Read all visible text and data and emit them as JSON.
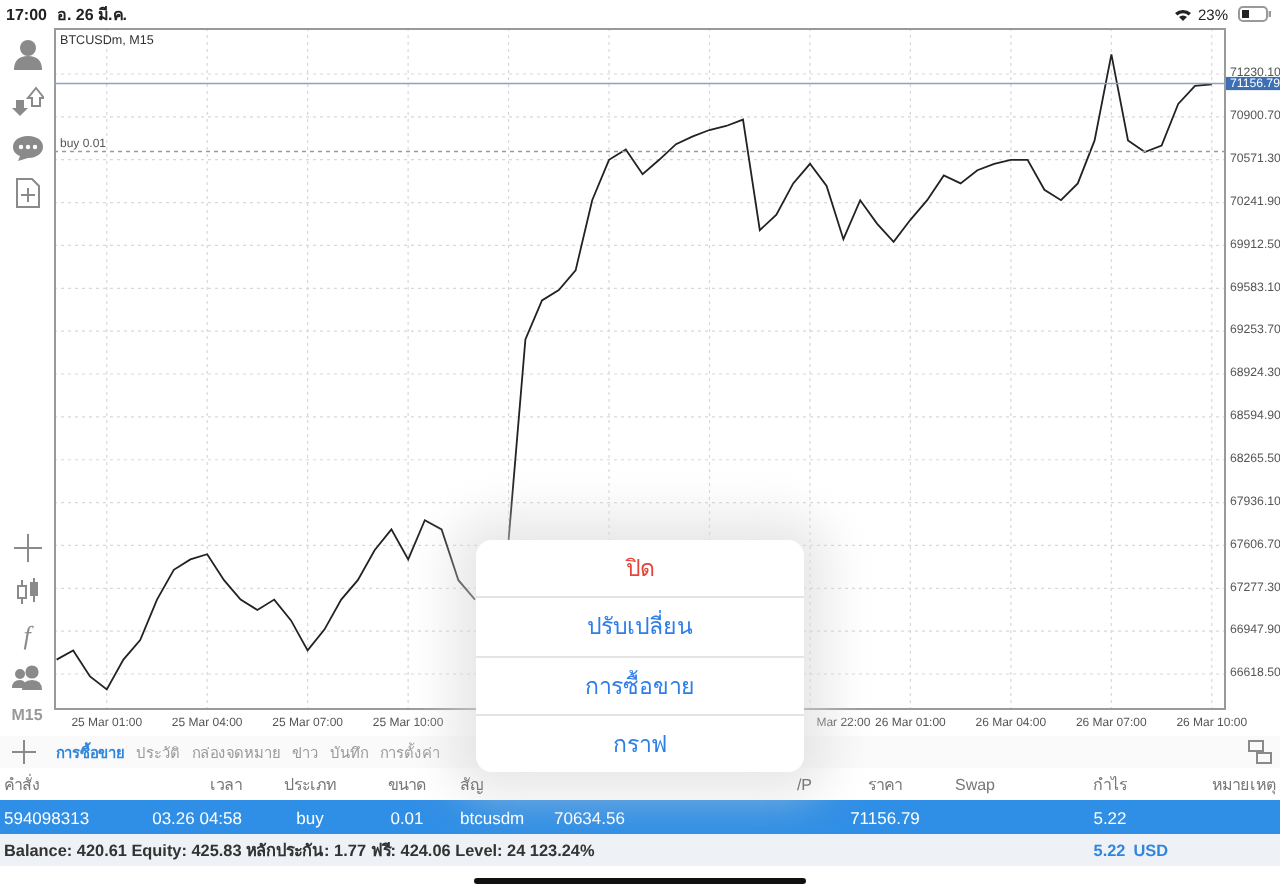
{
  "status_bar": {
    "time": "17:00",
    "date": "อ. 26 มี.ค.",
    "battery": "23%"
  },
  "toolbar": {
    "function_label": "f",
    "timeframe": "M15"
  },
  "chart": {
    "title": "BTCUSDm, M15",
    "current_price": "71156.79",
    "order_label": "buy 0.01",
    "chart_data": {
      "type": "line",
      "ylim": [
        66342,
        71583.6
      ],
      "grid": true,
      "categories": [
        null,
        null,
        null,
        "25 Mar 01:00",
        null,
        null,
        null,
        null,
        null,
        "25 Mar 04:00",
        null,
        null,
        null,
        null,
        null,
        "25 Mar 07:00",
        null,
        null,
        null,
        null,
        null,
        "25 Mar 10:00",
        null,
        null,
        null,
        null,
        null,
        null,
        null,
        null,
        null,
        null,
        null,
        null,
        null,
        null,
        null,
        null,
        null,
        null,
        null,
        null,
        null,
        null,
        null,
        null,
        null,
        "Mar 22:00",
        null,
        null,
        null,
        "26 Mar 01:00",
        null,
        null,
        null,
        null,
        null,
        "26 Mar 04:00",
        null,
        null,
        null,
        null,
        null,
        "26 Mar 07:00",
        null,
        null,
        null,
        null,
        null,
        "26 Mar 10:00"
      ],
      "yticks": [
        {
          "value": 71230.1,
          "label": "71230.10"
        },
        {
          "value": 70900.7,
          "label": "70900.70"
        },
        {
          "value": 70571.3,
          "label": "70571.30"
        },
        {
          "value": 70241.9,
          "label": "70241.90"
        },
        {
          "value": 69912.5,
          "label": "69912.50"
        },
        {
          "value": 69583.1,
          "label": "69583.10"
        },
        {
          "value": 69253.7,
          "label": "69253.70"
        },
        {
          "value": 68924.3,
          "label": "68924.30"
        },
        {
          "value": 68594.9,
          "label": "68594.90"
        },
        {
          "value": 68265.5,
          "label": "68265.50"
        },
        {
          "value": 67936.1,
          "label": "67936.10"
        },
        {
          "value": 67606.7,
          "label": "67606.70"
        },
        {
          "value": 67277.3,
          "label": "67277.30"
        },
        {
          "value": 66947.9,
          "label": "66947.90"
        },
        {
          "value": 66618.5,
          "label": "66618.50"
        }
      ],
      "series": [
        {
          "color": "#222222",
          "values": [
            66730,
            66800,
            66600,
            66500,
            66730,
            66880,
            67190,
            67420,
            67500,
            67540,
            67340,
            67190,
            67110,
            67190,
            67030,
            66800,
            66960,
            67190,
            67340,
            67570,
            67730,
            67500,
            67800,
            67730,
            67340,
            67190,
            null,
            67650,
            69190,
            69490,
            69570,
            69720,
            70260,
            70570,
            70650,
            70460,
            70570,
            70690,
            70750,
            70800,
            70830,
            70880,
            70030,
            70150,
            70390,
            70540,
            70370,
            69960,
            70260,
            70080,
            69940,
            70110,
            70260,
            70450,
            70390,
            70490,
            70540,
            70570,
            70570,
            70340,
            70260,
            70390,
            70720,
            71380,
            70720,
            70630,
            70680,
            71000,
            71140,
            71150
          ]
        }
      ]
    }
  },
  "tabs": [
    {
      "label": "การซื้อขาย",
      "selected": true
    },
    {
      "label": "ประวัติ",
      "selected": false
    },
    {
      "label": "กล่องจดหมาย",
      "selected": false
    },
    {
      "label": "ข่าว",
      "selected": false
    },
    {
      "label": "บันทึก",
      "selected": false
    },
    {
      "label": "การตั้งค่า",
      "selected": false
    }
  ],
  "table": {
    "columns": [
      "คำสั่ง",
      "เวลา",
      "ประเภท",
      "ขนาด",
      "สัญ",
      "/P",
      "ราคา",
      "Swap",
      "กำไร",
      "หมายเหตุ"
    ],
    "rows": [
      {
        "order": "594098313",
        "time": "03.26 04:58",
        "type": "buy",
        "volume": "0.01",
        "symbol": "btcusdm",
        "open_price": "70634.56",
        "price": "71156.79",
        "profit": "5.22",
        "selected": true
      }
    ]
  },
  "summary": {
    "text": "Balance: 420.61 Equity: 425.83 หลักประกัน: 1.77 ฟรี: 424.06 Level: 24 123.24%",
    "profit": "5.22",
    "currency": "USD"
  },
  "action_sheet": {
    "items": [
      {
        "label": "ปิด",
        "kind": "destructive"
      },
      {
        "label": "ปรับเปลี่ยน",
        "kind": "default"
      },
      {
        "label": "การซื้อขาย",
        "kind": "default"
      },
      {
        "label": "กราฟ",
        "kind": "default"
      }
    ]
  }
}
